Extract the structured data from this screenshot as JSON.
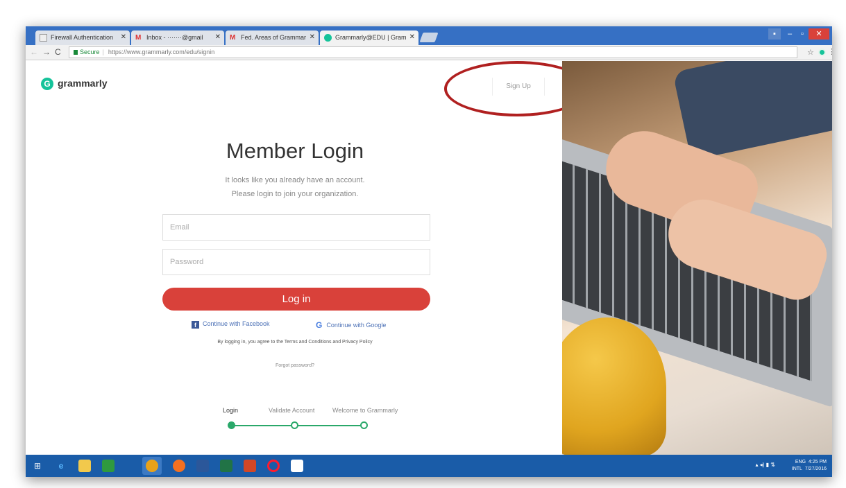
{
  "browser": {
    "tabs": [
      {
        "label": "Firewall Authentication",
        "icon": "doc-icon"
      },
      {
        "label": "Inbox - ·······@gmail",
        "icon": "gmail-icon"
      },
      {
        "label": "Fed. Areas of Grammar",
        "icon": "gmail-icon"
      },
      {
        "label": "Grammarly@EDU | Gram",
        "icon": "grammarly-icon"
      }
    ],
    "secure_label": "Secure",
    "url": "https://www.grammarly.com/edu/signin"
  },
  "page": {
    "logo_text": "grammarly",
    "signup_label": "Sign Up",
    "title": "Member Login",
    "subtitle_line1": "It looks like you already have an account.",
    "subtitle_line2": "Please login to join your organization.",
    "email_placeholder": "Email",
    "password_placeholder": "Password",
    "login_label": "Log in",
    "facebook_label": "Continue with Facebook",
    "google_label": "Continue with Google",
    "terms_text": "By logging in, you agree to the Terms and Conditions and Privacy Policy",
    "forgot_label": "Forgot password?",
    "steps": [
      "Login",
      "Validate Account",
      "Welcome to Grammarly"
    ]
  },
  "taskbar": {
    "apps": [
      "windows-start-icon",
      "ie-icon",
      "file-explorer-icon",
      "store-icon",
      "chrome-icon",
      "firefox-icon",
      "word-icon",
      "excel-icon",
      "powerpoint-icon",
      "opera-icon",
      "notepad-icon"
    ],
    "lang": "ENG",
    "lang2": "INTL",
    "time": "4:25 PM",
    "date": "7/27/2016"
  },
  "colors": {
    "brand": "#15c39a",
    "login_button": "#d9413a",
    "taskbar": "#1a5ca8",
    "annotation_ring": "#b02020"
  }
}
